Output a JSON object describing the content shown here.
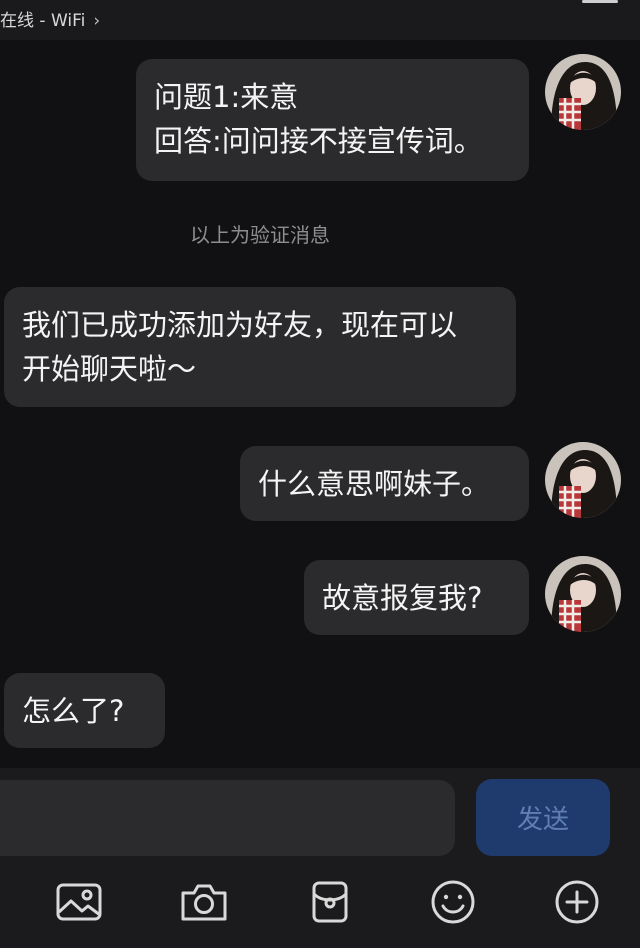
{
  "status_bar": {
    "connection_text": "在线 - WiFi",
    "chevron": "›"
  },
  "messages": [
    {
      "side": "right",
      "lines": [
        "问题1:来意",
        "回答:问问接不接宣传词。"
      ]
    },
    {
      "side": "system",
      "text": "以上为验证消息"
    },
    {
      "side": "left",
      "lines": [
        "我们已成功添加为好友，现在可以",
        "开始聊天啦～"
      ]
    },
    {
      "side": "right",
      "lines": [
        "什么意思啊妹子。"
      ]
    },
    {
      "side": "right",
      "lines": [
        "故意报复我?"
      ]
    },
    {
      "side": "left",
      "lines": [
        "怎么了?"
      ]
    }
  ],
  "composer": {
    "send_label": "发送",
    "input_value": ""
  },
  "toolbar": {
    "icons": [
      "image-icon",
      "camera-icon",
      "red-packet-icon",
      "emoji-icon",
      "plus-icon"
    ]
  }
}
